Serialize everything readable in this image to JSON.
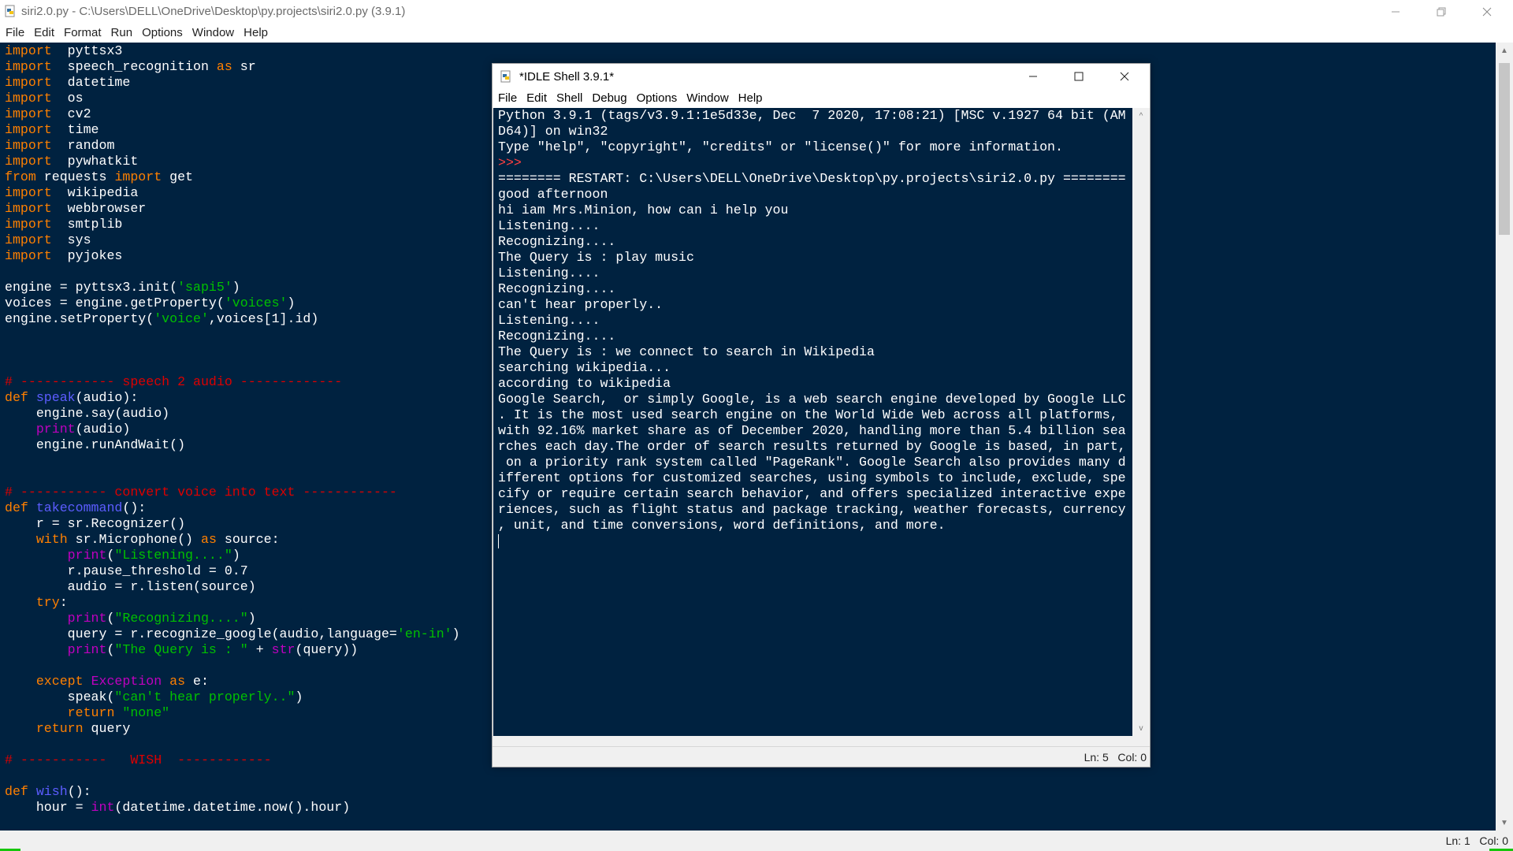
{
  "editor_window": {
    "title": "siri2.0.py - C:\\Users\\DELL\\OneDrive\\Desktop\\py.projects\\siri2.0.py (3.9.1)",
    "menu": [
      "File",
      "Edit",
      "Format",
      "Run",
      "Options",
      "Window",
      "Help"
    ],
    "status": "Ln: 1   Col: 0",
    "code_lines": [
      [
        [
          "kw",
          "import"
        ],
        [
          "",
          "  pyttsx3"
        ]
      ],
      [
        [
          "kw",
          "import"
        ],
        [
          "",
          "  speech_recognition "
        ],
        [
          "kw",
          "as"
        ],
        [
          "",
          " sr"
        ]
      ],
      [
        [
          "kw",
          "import"
        ],
        [
          "",
          "  datetime"
        ]
      ],
      [
        [
          "kw",
          "import"
        ],
        [
          "",
          "  os"
        ]
      ],
      [
        [
          "kw",
          "import"
        ],
        [
          "",
          "  cv2"
        ]
      ],
      [
        [
          "kw",
          "import"
        ],
        [
          "",
          "  time"
        ]
      ],
      [
        [
          "kw",
          "import"
        ],
        [
          "",
          "  random"
        ]
      ],
      [
        [
          "kw",
          "import"
        ],
        [
          "",
          "  pywhatkit"
        ]
      ],
      [
        [
          "kw",
          "from"
        ],
        [
          "",
          " requests "
        ],
        [
          "kw",
          "import"
        ],
        [
          "",
          " get"
        ]
      ],
      [
        [
          "kw",
          "import"
        ],
        [
          "",
          "  wikipedia"
        ]
      ],
      [
        [
          "kw",
          "import"
        ],
        [
          "",
          "  webbrowser"
        ]
      ],
      [
        [
          "kw",
          "import"
        ],
        [
          "",
          "  smtplib"
        ]
      ],
      [
        [
          "kw",
          "import"
        ],
        [
          "",
          "  sys"
        ]
      ],
      [
        [
          "kw",
          "import"
        ],
        [
          "",
          "  pyjokes"
        ]
      ],
      [],
      [
        [
          "",
          "engine = pyttsx3.init("
        ],
        [
          "st",
          "'sapi5'"
        ],
        [
          "",
          ")"
        ]
      ],
      [
        [
          "",
          "voices = engine.getProperty("
        ],
        [
          "st",
          "'voices'"
        ],
        [
          "",
          ")"
        ]
      ],
      [
        [
          "",
          "engine.setProperty("
        ],
        [
          "st",
          "'voice'"
        ],
        [
          "",
          ",voices[1].id)"
        ]
      ],
      [],
      [],
      [],
      [
        [
          "cm",
          "# ------------ speech 2 audio -------------"
        ]
      ],
      [
        [
          "kw",
          "def"
        ],
        [
          "",
          " "
        ],
        [
          "df",
          "speak"
        ],
        [
          "",
          "(audio):"
        ]
      ],
      [
        [
          "",
          "    engine.say(audio)"
        ]
      ],
      [
        [
          "",
          "    "
        ],
        [
          "bi",
          "print"
        ],
        [
          "",
          "(audio)"
        ]
      ],
      [
        [
          "",
          "    engine.runAndWait()"
        ]
      ],
      [],
      [],
      [
        [
          "cm",
          "# ----------- convert voice into text ------------"
        ]
      ],
      [
        [
          "kw",
          "def"
        ],
        [
          "",
          " "
        ],
        [
          "df",
          "takecommand"
        ],
        [
          "",
          "():"
        ]
      ],
      [
        [
          "",
          "    r = sr.Recognizer()"
        ]
      ],
      [
        [
          "",
          "    "
        ],
        [
          "kw",
          "with"
        ],
        [
          "",
          " sr.Microphone() "
        ],
        [
          "kw",
          "as"
        ],
        [
          "",
          " source:"
        ]
      ],
      [
        [
          "",
          "        "
        ],
        [
          "bi",
          "print"
        ],
        [
          "",
          "("
        ],
        [
          "st",
          "\"Listening....\""
        ],
        [
          "",
          ")"
        ]
      ],
      [
        [
          "",
          "        r.pause_threshold = 0.7"
        ]
      ],
      [
        [
          "",
          "        audio = r.listen(source)"
        ]
      ],
      [
        [
          "",
          "    "
        ],
        [
          "kw",
          "try"
        ],
        [
          "",
          ":"
        ]
      ],
      [
        [
          "",
          "        "
        ],
        [
          "bi",
          "print"
        ],
        [
          "",
          "("
        ],
        [
          "st",
          "\"Recognizing....\""
        ],
        [
          "",
          ")"
        ]
      ],
      [
        [
          "",
          "        query = r.recognize_google(audio,language="
        ],
        [
          "st",
          "'en-in'"
        ],
        [
          "",
          ")"
        ]
      ],
      [
        [
          "",
          "        "
        ],
        [
          "bi",
          "print"
        ],
        [
          "",
          "("
        ],
        [
          "st",
          "\"The Query is : \""
        ],
        [
          "",
          " + "
        ],
        [
          "bi",
          "str"
        ],
        [
          "",
          "(query))"
        ]
      ],
      [],
      [
        [
          "",
          "    "
        ],
        [
          "kw",
          "except"
        ],
        [
          "",
          " "
        ],
        [
          "bi",
          "Exception"
        ],
        [
          "",
          " "
        ],
        [
          "kw",
          "as"
        ],
        [
          "",
          " e:"
        ]
      ],
      [
        [
          "",
          "        speak("
        ],
        [
          "st",
          "\"can't hear properly..\""
        ],
        [
          "",
          ")"
        ]
      ],
      [
        [
          "",
          "        "
        ],
        [
          "kw",
          "return"
        ],
        [
          "",
          " "
        ],
        [
          "st",
          "\"none\""
        ]
      ],
      [
        [
          "",
          "    "
        ],
        [
          "kw",
          "return"
        ],
        [
          "",
          " query"
        ]
      ],
      [],
      [
        [
          "cm",
          "# -----------   WISH  ------------"
        ]
      ],
      [],
      [
        [
          "kw",
          "def"
        ],
        [
          "",
          " "
        ],
        [
          "df",
          "wish"
        ],
        [
          "",
          "():"
        ]
      ],
      [
        [
          "",
          "    hour = "
        ],
        [
          "bi",
          "int"
        ],
        [
          "",
          "(datetime.datetime.now().hour)"
        ]
      ]
    ]
  },
  "shell_window": {
    "title": "*IDLE Shell 3.9.1*",
    "menu": [
      "File",
      "Edit",
      "Shell",
      "Debug",
      "Options",
      "Window",
      "Help"
    ],
    "status": "Ln: 5   Col: 0",
    "output_lines": [
      "Python 3.9.1 (tags/v3.9.1:1e5d33e, Dec  7 2020, 17:08:21) [MSC v.1927 64 bit (AM",
      "D64)] on win32",
      "Type \"help\", \"copyright\", \"credits\" or \"license()\" for more information.",
      ">>> ",
      "======== RESTART: C:\\Users\\DELL\\OneDrive\\Desktop\\py.projects\\siri2.0.py ========",
      "good afternoon",
      "hi iam Mrs.Minion, how can i help you",
      "Listening....",
      "Recognizing....",
      "The Query is : play music",
      "Listening....",
      "Recognizing....",
      "can't hear properly..",
      "Listening....",
      "Recognizing....",
      "The Query is : we connect to search in Wikipedia",
      "searching wikipedia...",
      "according to wikipedia",
      "Google Search,  or simply Google, is a web search engine developed by Google LLC",
      ". It is the most used search engine on the World Wide Web across all platforms,",
      "with 92.16% market share as of December 2020, handling more than 5.4 billion sea",
      "rches each day.The order of search results returned by Google is based, in part,",
      " on a priority rank system called \"PageRank\". Google Search also provides many d",
      "ifferent options for customized searches, using symbols to include, exclude, spe",
      "cify or require certain search behavior, and offers specialized interactive expe",
      "riences, such as flight status and package tracking, weather forecasts, currency",
      ", unit, and time conversions, word definitions, and more."
    ]
  },
  "icons": {
    "app": "python-file-icon",
    "minimize": "minimize-icon",
    "maximize": "maximize-icon",
    "close": "close-icon"
  },
  "colors": {
    "editor_bg": "#002240",
    "keyword": "#ff8000",
    "builtin": "#c000c0",
    "string": "#00c000",
    "comment": "#dd0000",
    "definition": "#5c5cff",
    "prompt": "#ff4040"
  }
}
